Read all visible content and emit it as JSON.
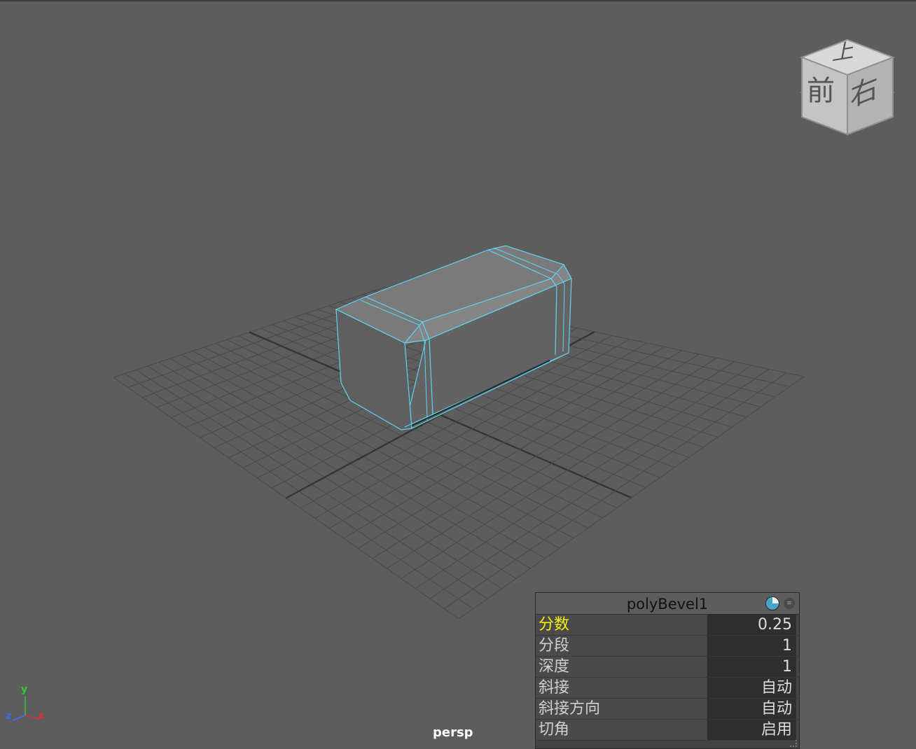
{
  "viewport": {
    "camera_label": "persp",
    "background_color": "#5d5d5d",
    "grid_color": "#494949",
    "grid_axis_color": "#353535",
    "selection_color": "#5fd3f3"
  },
  "view_cube": {
    "top_label": "上",
    "front_label": "前",
    "right_label": "右"
  },
  "axis_gizmo": {
    "x_label": "x",
    "y_label": "y",
    "z_label": "z"
  },
  "channel_box": {
    "title": "polyBevel1",
    "rows": [
      {
        "name": "分数",
        "value": "0.25"
      },
      {
        "name": "分段",
        "value": "1"
      },
      {
        "name": "深度",
        "value": "1"
      },
      {
        "name": "斜接",
        "value": "自动"
      },
      {
        "name": "斜接方向",
        "value": "自动"
      },
      {
        "name": "切角",
        "value": "启用"
      }
    ]
  }
}
